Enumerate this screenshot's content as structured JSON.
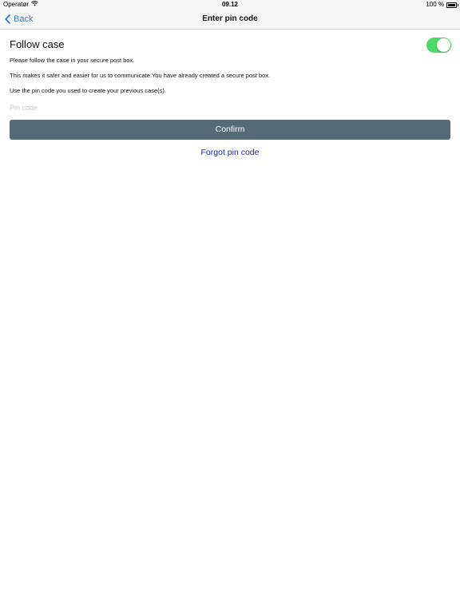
{
  "status_bar": {
    "carrier": "Operatør",
    "time": "09.12",
    "battery": "100 %",
    "battery_level": 1.0
  },
  "nav": {
    "back_label": "Back",
    "title": "Enter pin code"
  },
  "follow_case": {
    "label": "Follow case",
    "toggle_on": true,
    "toggle_color": "#4cd964"
  },
  "paragraphs": [
    "Please follow the case in your secure post box.",
    "This makes it safer and easier for us to communicate.You have already created a secure post box.",
    "Use the pin code you used to create your previous case(s)."
  ],
  "pin_input": {
    "value": "",
    "placeholder": "Pin code"
  },
  "confirm_button": {
    "label": "Confirm",
    "color": "#546a77"
  },
  "forgot_link": {
    "label": "Forgot pin code",
    "color": "#1a1acc"
  },
  "icons": {
    "wifi": "wifi-icon",
    "battery": "battery-icon",
    "back": "chevron-left-icon"
  }
}
